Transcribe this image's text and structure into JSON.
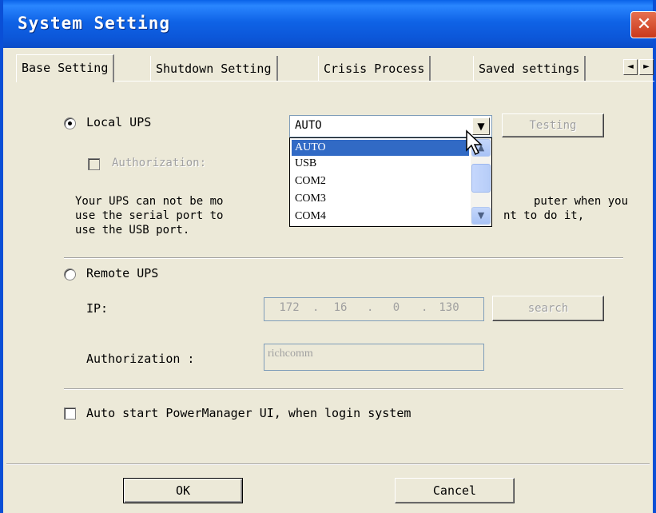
{
  "window": {
    "title": "System Setting",
    "close_glyph": "✕"
  },
  "tabs": [
    {
      "label": "Base Setting"
    },
    {
      "label": "Shutdown Setting"
    },
    {
      "label": "Crisis Process"
    },
    {
      "label": "Saved settings"
    }
  ],
  "tab_scroll": {
    "left": "◄",
    "right": "►"
  },
  "local_ups": {
    "label": "Local UPS",
    "selected": true,
    "port_value": "AUTO",
    "testing_button": "Testing",
    "authorization_label": "Authorization:",
    "note_lines": [
      "Your UPS can not be mo",
      "use the serial port to",
      "use the USB port."
    ],
    "note_right_lines": [
      "puter when you",
      "nt to do it,"
    ]
  },
  "port_options": [
    "AUTO",
    "USB",
    "COM2",
    "COM3",
    "COM4"
  ],
  "remote_ups": {
    "label": "Remote UPS",
    "selected": false,
    "ip_label": "IP:",
    "ip_parts": [
      "172",
      "16",
      "0",
      "130"
    ],
    "search_button": "search",
    "authorization_label": "Authorization :",
    "authorization_value": "richcomm"
  },
  "auto_start": {
    "label": "Auto start PowerManager UI, when login system",
    "checked": false
  },
  "buttons": {
    "ok": "OK",
    "cancel": "Cancel"
  },
  "colors": {
    "titlebar": "#0c56d8",
    "selection": "#316ac5",
    "face": "#ece9d8"
  }
}
